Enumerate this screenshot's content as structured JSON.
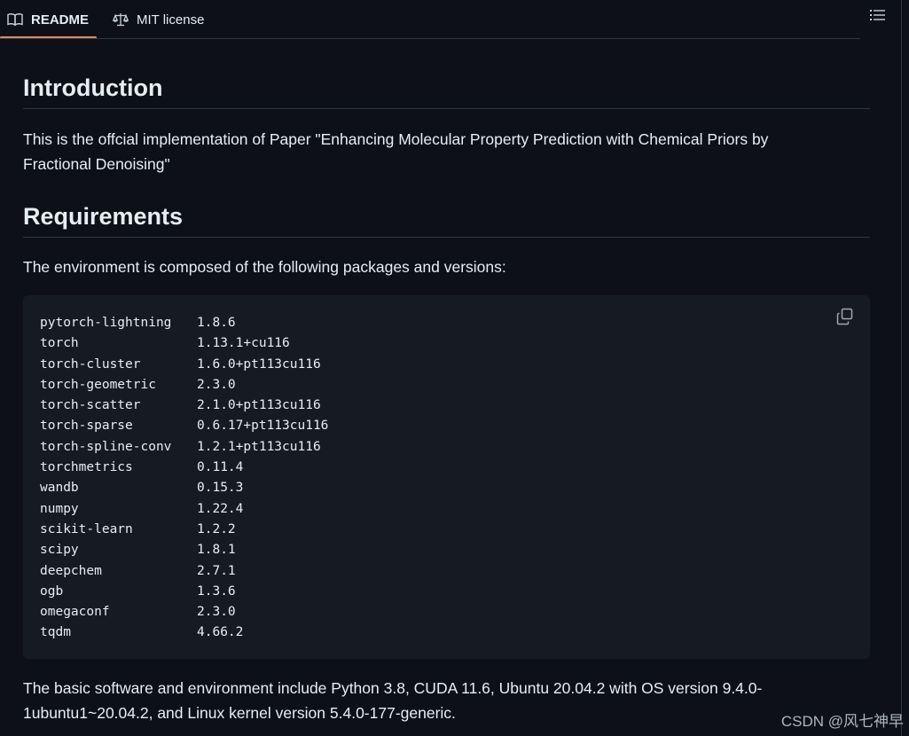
{
  "tabs": {
    "readme_label": "README",
    "license_label": "MIT license",
    "readme_icon": "book-icon",
    "license_icon": "law-scale-icon",
    "toc_icon": "list-unordered-icon"
  },
  "intro": {
    "heading": "Introduction",
    "text": "This is the offcial implementation of Paper \"Enhancing Molecular Property Prediction with Chemical Priors by Fractional Denoising\""
  },
  "requirements": {
    "heading": "Requirements",
    "text": "The environment is composed of the following packages and versions:",
    "copy_icon": "copy-icon",
    "packages": [
      {
        "name": "pytorch-lightning",
        "version": "1.8.6"
      },
      {
        "name": "torch",
        "version": "1.13.1+cu116"
      },
      {
        "name": "torch-cluster",
        "version": "1.6.0+pt113cu116"
      },
      {
        "name": "torch-geometric",
        "version": "2.3.0"
      },
      {
        "name": "torch-scatter",
        "version": "2.1.0+pt113cu116"
      },
      {
        "name": "torch-sparse",
        "version": "0.6.17+pt113cu116"
      },
      {
        "name": "torch-spline-conv",
        "version": "1.2.1+pt113cu116"
      },
      {
        "name": "torchmetrics",
        "version": "0.11.4"
      },
      {
        "name": "wandb",
        "version": "0.15.3"
      },
      {
        "name": "numpy",
        "version": "1.22.4"
      },
      {
        "name": "scikit-learn",
        "version": "1.2.2"
      },
      {
        "name": "scipy",
        "version": "1.8.1"
      },
      {
        "name": "deepchem",
        "version": "2.7.1"
      },
      {
        "name": "ogb",
        "version": "1.3.6"
      },
      {
        "name": "omegaconf",
        "version": "2.3.0"
      },
      {
        "name": "tqdm",
        "version": "4.66.2"
      }
    ],
    "basic_text": "The basic software and environment include Python 3.8, CUDA 11.6, Ubuntu 20.04.2 with OS version 9.4.0-1ubuntu1~20.04.2, and Linux kernel version 5.4.0-177-generic."
  },
  "watermark": "CSDN @风七神早",
  "colors": {
    "background": "#0d1117",
    "code_background": "#161b22",
    "border": "#30363d",
    "accent_underline": "#f78166",
    "text": "#e6edf3"
  }
}
